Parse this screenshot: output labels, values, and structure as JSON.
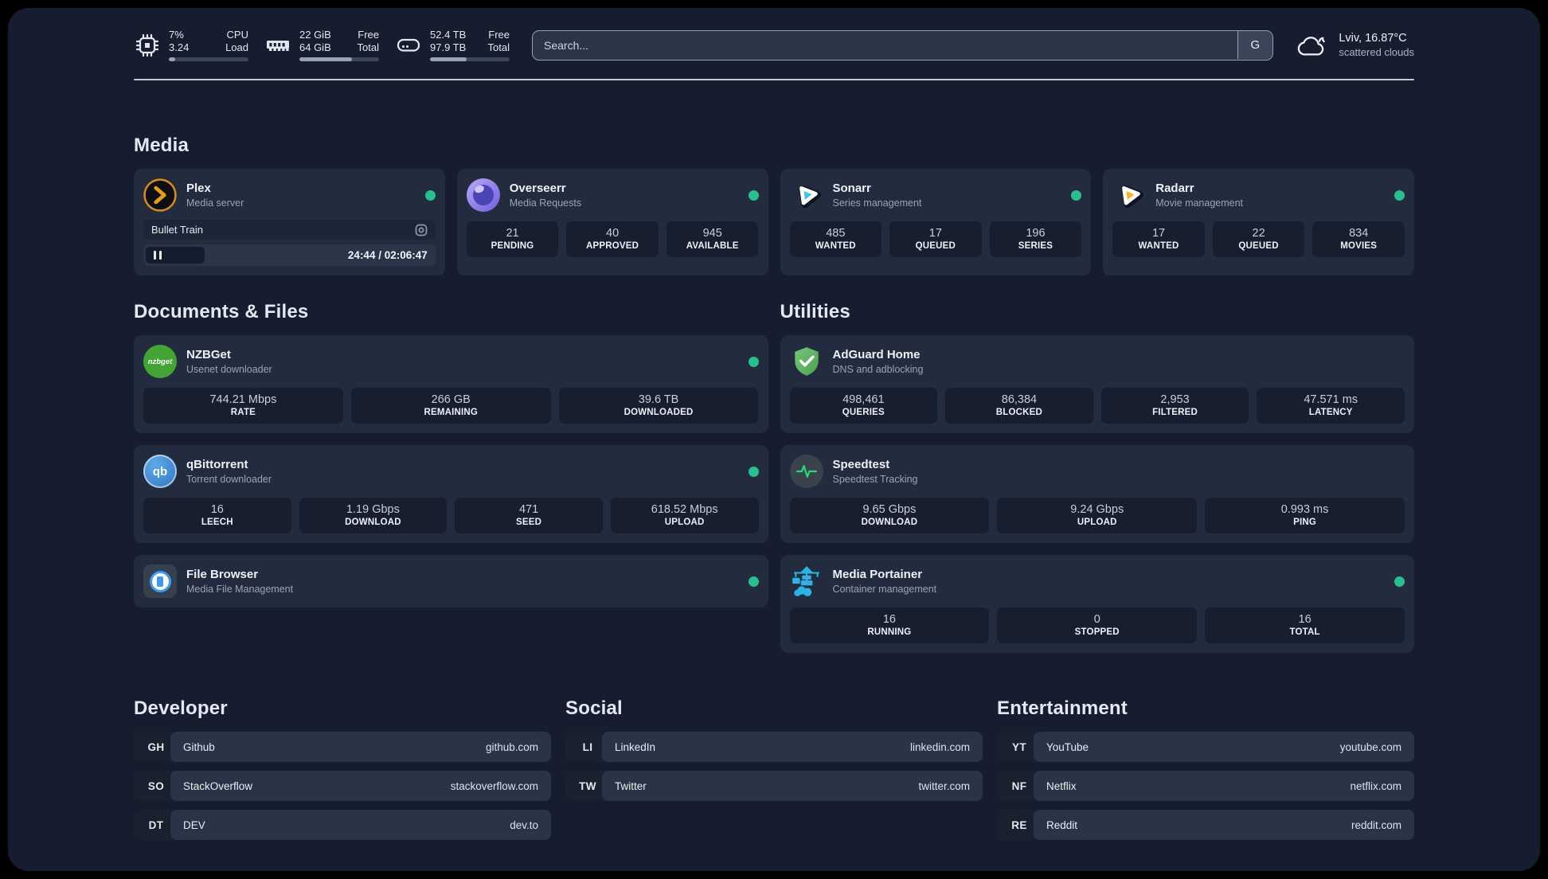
{
  "palette": {
    "background": "#161d2e",
    "card": "#232c3e",
    "stat_block": "#1a2232",
    "status_online": "#26bf8d",
    "text_primary": "#eef1f6",
    "text_secondary": "#9aa4b5"
  },
  "header": {
    "resources": [
      {
        "icon": "cpu-icon",
        "values": [
          "7%",
          "3.24"
        ],
        "labels": [
          "CPU",
          "Load"
        ],
        "progress_pct": 8
      },
      {
        "icon": "memory-icon",
        "values": [
          "22 GiB",
          "64 GiB"
        ],
        "labels": [
          "Free",
          "Total"
        ],
        "progress_pct": 66
      },
      {
        "icon": "disk-icon",
        "values": [
          "52.4 TB",
          "97.9 TB"
        ],
        "labels": [
          "Free",
          "Total"
        ],
        "progress_pct": 46
      }
    ],
    "search": {
      "placeholder": "Search...",
      "button_label": "G"
    },
    "weather": {
      "location_temp": "Lviv, 16.87°C",
      "condition": "scattered clouds"
    }
  },
  "groups": {
    "media": {
      "title": "Media",
      "services": [
        {
          "name": "Plex",
          "description": "Media server",
          "status": "online",
          "now_playing": {
            "title": "Bullet Train",
            "time": "24:44 / 02:06:47",
            "state": "paused"
          }
        },
        {
          "name": "Overseerr",
          "description": "Media Requests",
          "status": "online",
          "stats": [
            {
              "value": "21",
              "label": "PENDING"
            },
            {
              "value": "40",
              "label": "APPROVED"
            },
            {
              "value": "945",
              "label": "AVAILABLE"
            }
          ]
        },
        {
          "name": "Sonarr",
          "description": "Series management",
          "status": "online",
          "stats": [
            {
              "value": "485",
              "label": "WANTED"
            },
            {
              "value": "17",
              "label": "QUEUED"
            },
            {
              "value": "196",
              "label": "SERIES"
            }
          ]
        },
        {
          "name": "Radarr",
          "description": "Movie management",
          "status": "online",
          "stats": [
            {
              "value": "17",
              "label": "WANTED"
            },
            {
              "value": "22",
              "label": "QUEUED"
            },
            {
              "value": "834",
              "label": "MOVIES"
            }
          ]
        }
      ]
    },
    "documents": {
      "title": "Documents & Files",
      "services": [
        {
          "name": "NZBGet",
          "description": "Usenet downloader",
          "status": "online",
          "stats": [
            {
              "value": "744.21 Mbps",
              "label": "RATE"
            },
            {
              "value": "266 GB",
              "label": "REMAINING"
            },
            {
              "value": "39.6 TB",
              "label": "DOWNLOADED"
            }
          ]
        },
        {
          "name": "qBittorrent",
          "description": "Torrent downloader",
          "status": "online",
          "stats": [
            {
              "value": "16",
              "label": "LEECH"
            },
            {
              "value": "1.19 Gbps",
              "label": "DOWNLOAD"
            },
            {
              "value": "471",
              "label": "SEED"
            },
            {
              "value": "618.52 Mbps",
              "label": "UPLOAD"
            }
          ]
        },
        {
          "name": "File Browser",
          "description": "Media File Management",
          "status": "online"
        }
      ]
    },
    "utilities": {
      "title": "Utilities",
      "services": [
        {
          "name": "AdGuard Home",
          "description": "DNS and adblocking",
          "stats": [
            {
              "value": "498,461",
              "label": "QUERIES"
            },
            {
              "value": "86,384",
              "label": "BLOCKED"
            },
            {
              "value": "2,953",
              "label": "FILTERED"
            },
            {
              "value": "47.571 ms",
              "label": "LATENCY"
            }
          ]
        },
        {
          "name": "Speedtest",
          "description": "Speedtest Tracking",
          "stats": [
            {
              "value": "9.65 Gbps",
              "label": "DOWNLOAD"
            },
            {
              "value": "9.24 Gbps",
              "label": "UPLOAD"
            },
            {
              "value": "0.993 ms",
              "label": "PING"
            }
          ]
        },
        {
          "name": "Media Portainer",
          "description": "Container management",
          "status": "online",
          "stats": [
            {
              "value": "16",
              "label": "RUNNING"
            },
            {
              "value": "0",
              "label": "STOPPED"
            },
            {
              "value": "16",
              "label": "TOTAL"
            }
          ]
        }
      ]
    }
  },
  "icons": {
    "nzbget_logo_text": "nzbget",
    "qbittorrent_monogram": "qb"
  },
  "bookmarks": [
    {
      "title": "Developer",
      "items": [
        {
          "abbr": "GH",
          "name": "Github",
          "url": "github.com"
        },
        {
          "abbr": "SO",
          "name": "StackOverflow",
          "url": "stackoverflow.com"
        },
        {
          "abbr": "DT",
          "name": "DEV",
          "url": "dev.to"
        }
      ]
    },
    {
      "title": "Social",
      "items": [
        {
          "abbr": "LI",
          "name": "LinkedIn",
          "url": "linkedin.com"
        },
        {
          "abbr": "TW",
          "name": "Twitter",
          "url": "twitter.com"
        }
      ]
    },
    {
      "title": "Entertainment",
      "items": [
        {
          "abbr": "YT",
          "name": "YouTube",
          "url": "youtube.com"
        },
        {
          "abbr": "NF",
          "name": "Netflix",
          "url": "netflix.com"
        },
        {
          "abbr": "RE",
          "name": "Reddit",
          "url": "reddit.com"
        }
      ]
    }
  ]
}
